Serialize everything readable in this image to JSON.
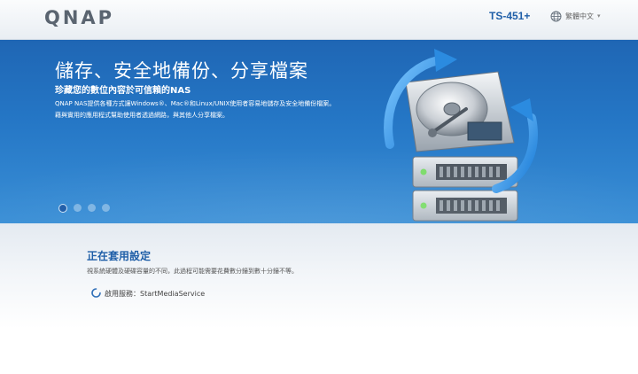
{
  "header": {
    "logo": "QNAP",
    "model": "TS-451+",
    "language": "繁體中文",
    "language_icon": "globe-icon",
    "caret": "▾"
  },
  "banner": {
    "headline": "儲存、安全地備份、分享檔案",
    "subhead": "珍藏您的數位內容於可信賴的NAS",
    "description": "QNAP NAS提供各種方式讓Windows®、Mac®和Linux/UNIX使用者容易地儲存及安全地備份檔案。藉與實用的應用程式幫助使用者透過網路，與其他人分享檔案。",
    "slides": [
      {
        "active": true
      },
      {
        "active": false
      },
      {
        "active": false
      },
      {
        "active": false
      }
    ],
    "illustration": "hard-drive-sync-icon"
  },
  "status": {
    "title": "正在套用設定",
    "description": "視系統硬體及硬碟容量的不同，此過程可能需要花費數分鐘到數十分鐘不等。",
    "service_label": "啟用服務：StartMediaService",
    "spinner_icon": "spinner-icon"
  },
  "colors": {
    "brand_blue": "#1f5fa8",
    "banner_top": "#1f66b4",
    "banner_bottom": "#3a8fd6"
  }
}
